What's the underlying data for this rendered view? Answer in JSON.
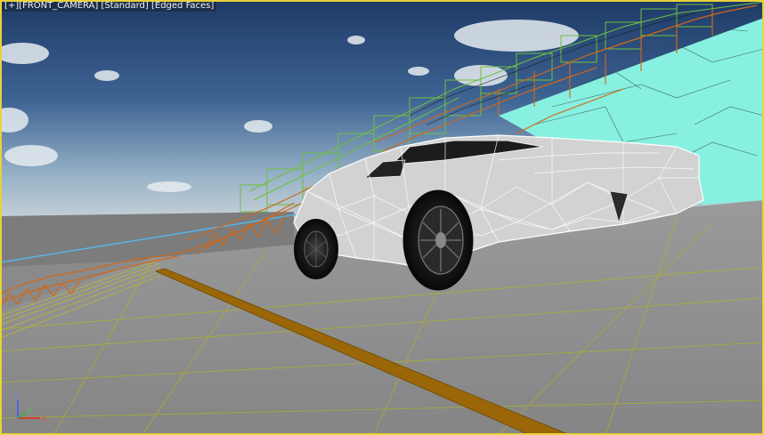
{
  "viewport": {
    "label_menu": "[+]",
    "label_view": "[FRONT_CAMERA]",
    "label_shading": "[Standard]",
    "label_mode": "[Edged Faces]",
    "gizmo_axes": [
      "x",
      "y",
      "z"
    ]
  },
  "colors": {
    "active_border": "#e8d23a",
    "sky_top": "#2a4a78",
    "sky_horizon": "#b8c8d4",
    "ground": "#8c8c8c",
    "road_line": "#9a6a0c",
    "wire_green": "#6ec040",
    "wire_orange": "#d06818",
    "wire_cyan": "#88f0e0",
    "car_body": "#d2d2d2"
  }
}
